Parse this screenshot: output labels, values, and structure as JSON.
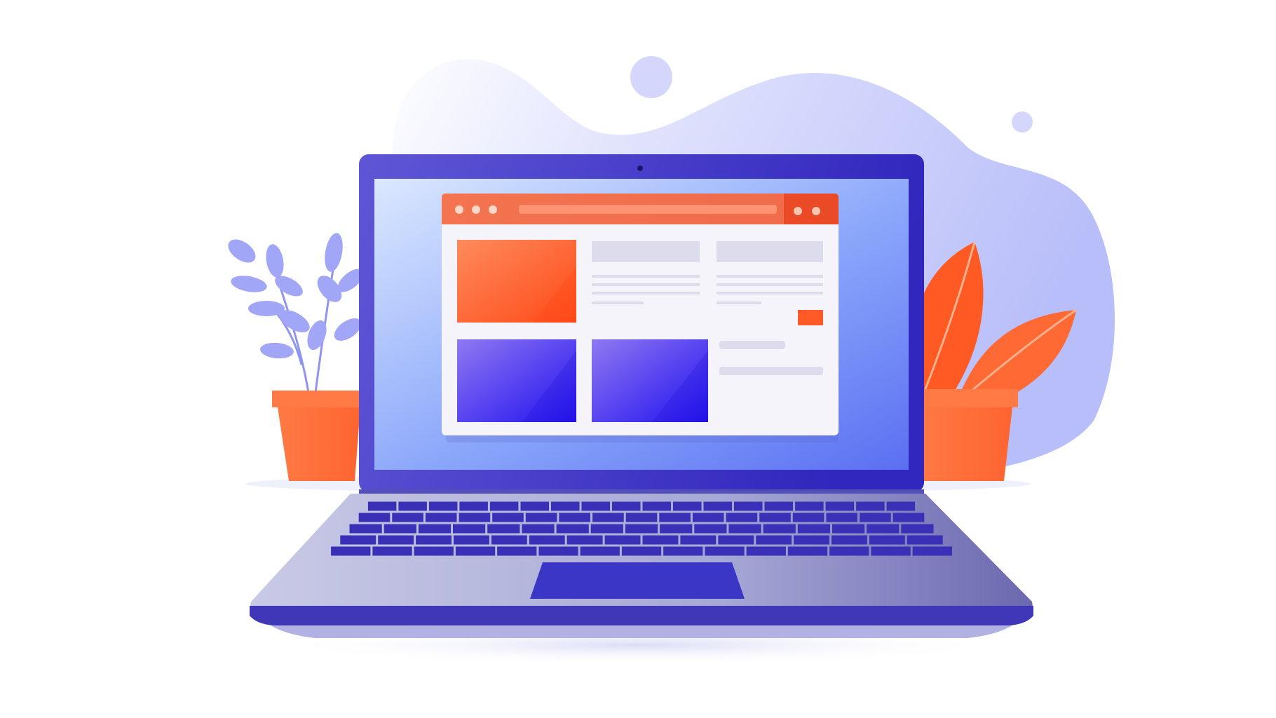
{
  "scene": {
    "subject": "laptop-illustration",
    "icons": [
      "laptop-icon",
      "webcam-icon",
      "browser-window-icon",
      "plant-icon",
      "pot-icon",
      "keyboard-icon",
      "touchpad-icon"
    ]
  },
  "colors": {
    "background": "#ffffff",
    "blob": "#c9cdfb",
    "laptop_frame": "#3d32c4",
    "screen_light": "#dbe8ff",
    "screen_dark": "#5b6ff2",
    "browser_bar": "#ef6a4a",
    "browser_bar_dark": "#ea4a26",
    "orange_tile": "#ff5a28",
    "purple_tile": "#2f22f0",
    "placeholder_gray": "#dcdcec",
    "pot_orange": "#ff6a38",
    "leaf_lavender": "#9aa0f5",
    "leaf_orange": "#ff5a24",
    "keyboard_key": "#3a2fb7",
    "touchpad": "#3b36c6",
    "laptop_base": "#b9badb"
  }
}
